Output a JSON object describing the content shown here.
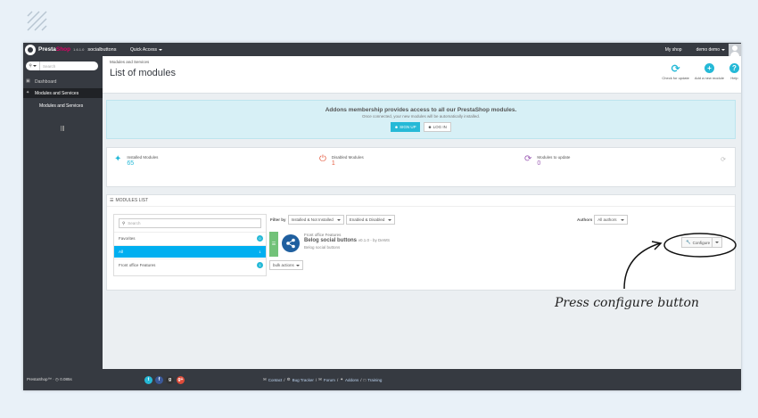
{
  "topbar": {
    "brand_prefix": "Presta",
    "brand_suffix": "Shop",
    "version": "1.6.1.0",
    "store_name": "socialbuttons",
    "quick_access": "Quick Access",
    "my_shop": "My shop",
    "employee": "demo demo"
  },
  "sidebar": {
    "search_placeholder": "Search",
    "items": [
      {
        "label": "Dashboard",
        "icon": "dashboard-icon"
      },
      {
        "label": "Modules and Services",
        "icon": "puzzle-icon"
      }
    ],
    "sub_item": "Modules and Services"
  },
  "header": {
    "breadcrumb": "Modules and Services",
    "title": "List of modules",
    "toolbar": [
      {
        "label": "Check for update",
        "icon": "refresh-icon"
      },
      {
        "label": "Add a new module",
        "icon": "add-icon"
      },
      {
        "label": "Help",
        "icon": "help-icon"
      }
    ]
  },
  "addons": {
    "title": "Addons membership provides access to all our PrestaShop modules.",
    "subtitle": "Once connected, your new modules will be automatically installed.",
    "signup": "SIGN UP",
    "login": "LOG IN"
  },
  "kpis": [
    {
      "label": "Installed Modules",
      "value": "65",
      "color": "#25b9d7",
      "icon": "puzzle-icon"
    },
    {
      "label": "Disabled Modules",
      "value": "1",
      "color": "#e4593d",
      "icon": "power-icon"
    },
    {
      "label": "Modules to update",
      "value": "0",
      "color": "#9c5cb4",
      "icon": "refresh-icon"
    }
  ],
  "modules_list": {
    "heading": "MODULES LIST",
    "search_placeholder": "Search",
    "categories": [
      {
        "label": "Favorites",
        "count": "0"
      },
      {
        "label": "All",
        "count": "1"
      },
      {
        "label": "Front office Features",
        "count": "1"
      }
    ],
    "filter_label": "Filter by",
    "filter_install": "Installed & Not Installed",
    "filter_enabled": "Enabled & Disabled",
    "authors_label": "Authors",
    "authors_value": "All authors",
    "module": {
      "category": "Front office Features",
      "name": "Belog social buttons",
      "version": "v0.1.0 - by DeWS",
      "description": "Belog social buttons"
    },
    "configure": "Configure",
    "bulk": "bulk actions"
  },
  "annotation": "Press configure button",
  "footer": {
    "brand": "PrestaShop™",
    "load_time": "0.085s",
    "social": [
      "t",
      "f",
      "g",
      "g+"
    ],
    "links": [
      "Contact",
      "Bug Tracker",
      "Forum",
      "Addons",
      "Training"
    ]
  },
  "colors": {
    "accent": "#25b9d7",
    "active_category": "#00aff0",
    "enabled_flag": "#72c279",
    "dark": "#363a41"
  }
}
